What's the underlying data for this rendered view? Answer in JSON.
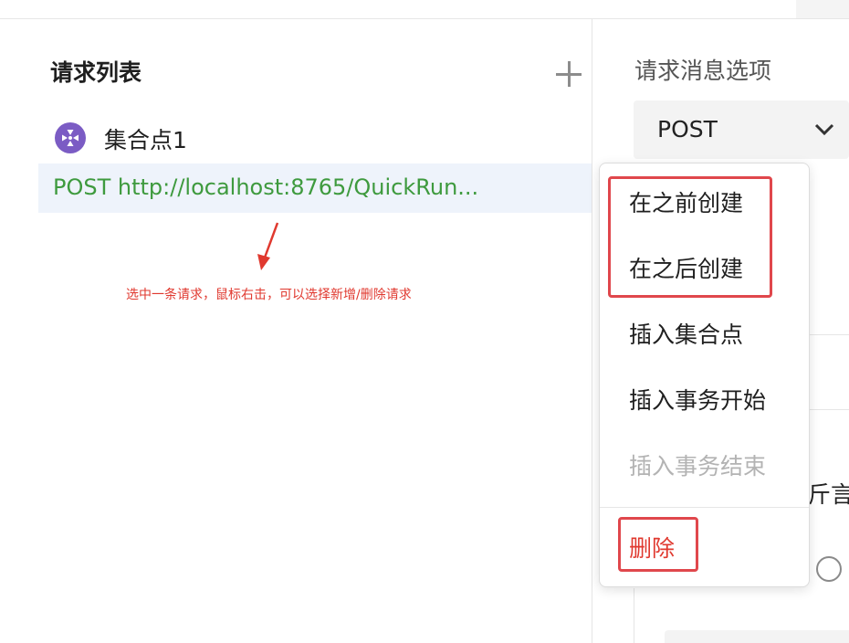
{
  "left_panel": {
    "title": "请求列表",
    "add_icon": "plus-icon",
    "rendezvous": {
      "icon": "rendezvous-point-icon",
      "label": "集合点1"
    },
    "request": {
      "label": "POST http://localhost:8765/QuickRun..."
    }
  },
  "annotation": {
    "text": "选中一条请求，鼠标右击，可以选择新增/删除请求"
  },
  "right_panel": {
    "section_title": "请求消息选项",
    "method": "POST",
    "partial_text": "斤言/"
  },
  "context_menu": {
    "items": [
      {
        "label": "在之前创建"
      },
      {
        "label": "在之后创建"
      },
      {
        "label": "插入集合点"
      },
      {
        "label": "插入事务开始"
      },
      {
        "label": "插入事务结束",
        "disabled": true
      },
      {
        "label": "删除",
        "danger": true
      }
    ]
  },
  "colors": {
    "accent_green": "#3e9a3e",
    "annotation_red": "#e0392f",
    "rendezvous_purple": "#7b5cc4",
    "selected_row_bg": "#eef3fb"
  }
}
